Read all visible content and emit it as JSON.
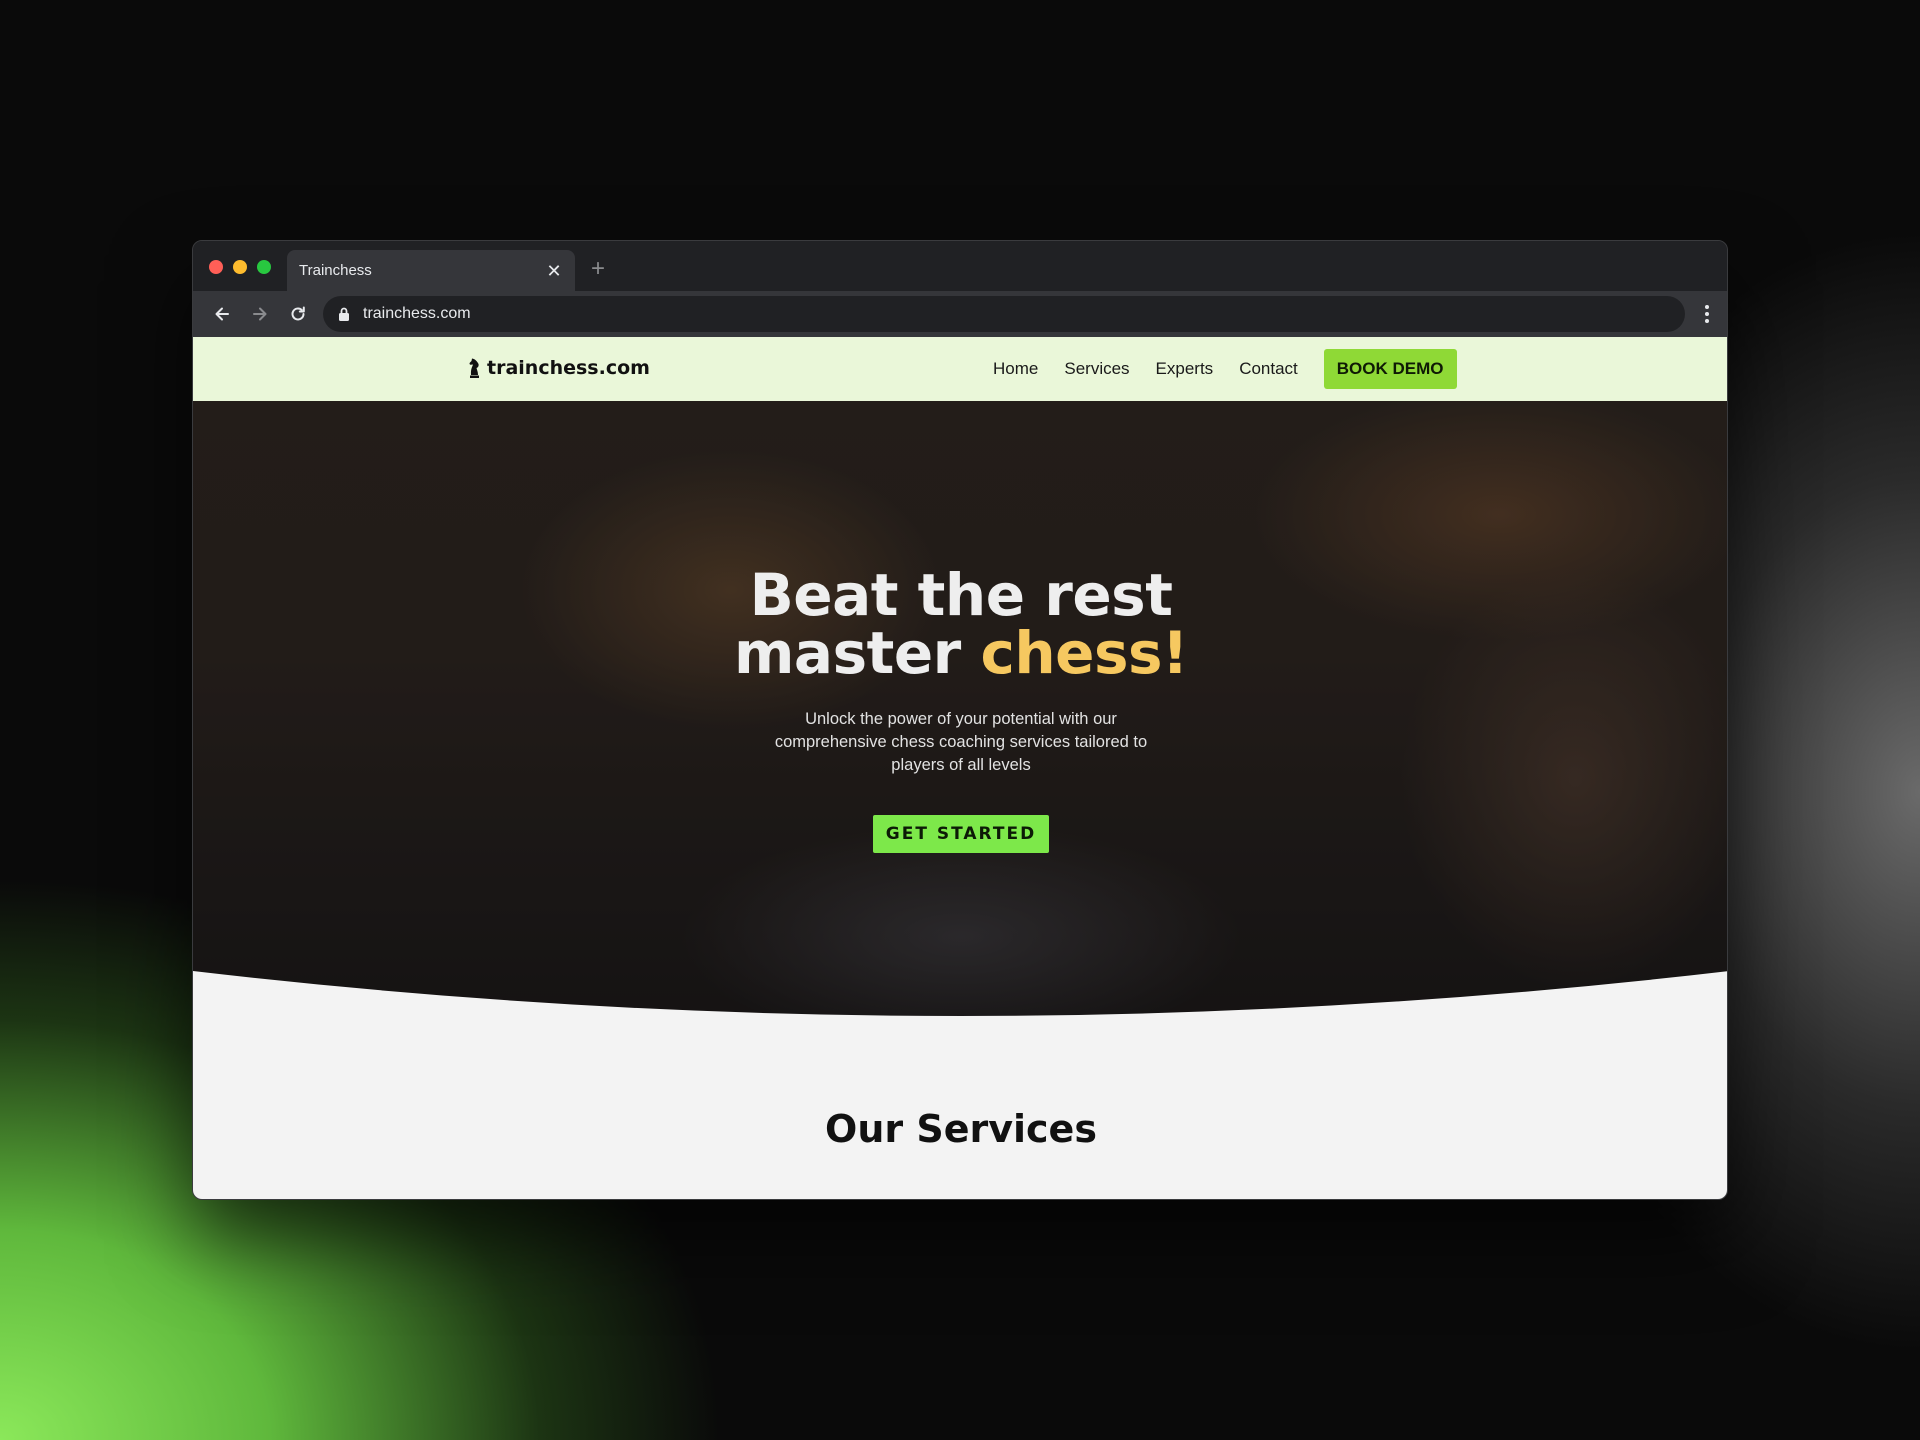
{
  "browser": {
    "tab_title": "Trainchess",
    "url": "trainchess.com"
  },
  "site": {
    "logo_text": "trainchess.com",
    "nav": [
      {
        "label": "Home"
      },
      {
        "label": "Services"
      },
      {
        "label": "Experts"
      },
      {
        "label": "Contact"
      }
    ],
    "book_demo_label": "BOOK DEMO"
  },
  "hero": {
    "title_line1": "Beat the rest",
    "title_line2_plain": "master ",
    "title_line2_accent": "chess!",
    "subtitle": "Unlock the power of your potential with our comprehensive chess coaching services tailored to players of all levels",
    "cta_label": "GET STARTED"
  },
  "services": {
    "heading": "Our Services"
  },
  "colors": {
    "accent_green": "#8fd936",
    "cta_green": "#7de84a",
    "accent_yellow": "#f6c860",
    "nav_bg": "#eaf7d9"
  }
}
